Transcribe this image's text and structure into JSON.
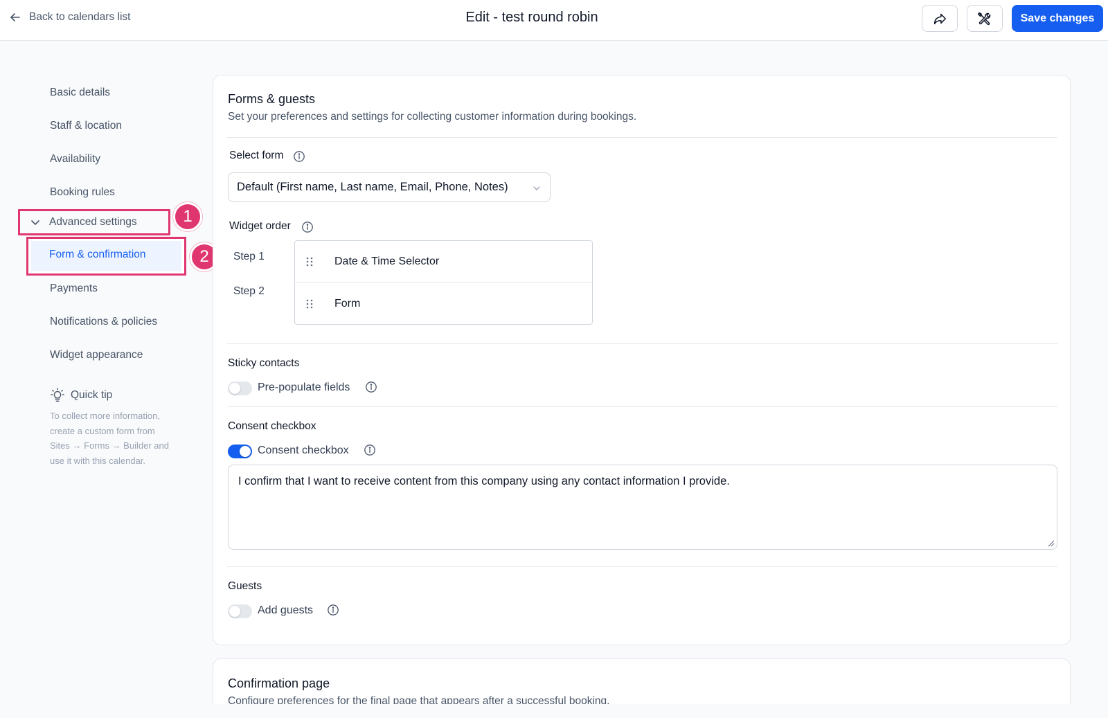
{
  "header": {
    "back_label": "Back to calendars list",
    "title": "Edit - test round robin",
    "save_label": "Save changes"
  },
  "sidebar": {
    "items": [
      {
        "label": "Basic details"
      },
      {
        "label": "Staff & location"
      },
      {
        "label": "Availability"
      },
      {
        "label": "Booking rules"
      },
      {
        "label": "Advanced settings"
      },
      {
        "label": "Form & confirmation"
      },
      {
        "label": "Payments"
      },
      {
        "label": "Notifications & policies"
      },
      {
        "label": "Widget appearance"
      }
    ],
    "active_item": "Form & confirmation",
    "badges": [
      "1",
      "2"
    ],
    "quick_tip": {
      "title": "Quick tip",
      "lines": [
        "To collect more information,",
        "create a custom form from",
        "Sites → Forms → Builder and",
        "use it with this calendar."
      ]
    }
  },
  "forms_guests": {
    "title": "Forms & guests",
    "description": "Set your preferences and settings for collecting customer information during bookings.",
    "select_form": {
      "label": "Select form",
      "value": "Default (First name, Last name, Email, Phone, Notes)"
    },
    "widget_order": {
      "label": "Widget order",
      "steps": [
        {
          "step": "Step 1",
          "name": "Date & Time Selector"
        },
        {
          "step": "Step 2",
          "name": "Form"
        }
      ]
    },
    "sticky_contacts": {
      "label": "Sticky contacts",
      "toggle_label": "Pre-populate fields",
      "enabled": false
    },
    "consent": {
      "label": "Consent checkbox",
      "toggle_label": "Consent checkbox",
      "enabled": true,
      "text": "I confirm that I want to receive content from this company using any contact information I provide."
    },
    "guests": {
      "label": "Guests",
      "toggle_label": "Add guests",
      "enabled": false
    }
  },
  "confirmation_page": {
    "title": "Confirmation page",
    "description": "Configure preferences for the final page that appears after a successful booking."
  },
  "colors": {
    "accent": "#155eef",
    "highlight": "#e0366f",
    "active_bg": "#eef4ff"
  },
  "icons": [
    "arrow-left-icon",
    "share-icon",
    "tools-icon",
    "chevron-down-icon",
    "info-icon",
    "drag-handle-icon",
    "lightbulb-icon",
    "resize-icon"
  ]
}
